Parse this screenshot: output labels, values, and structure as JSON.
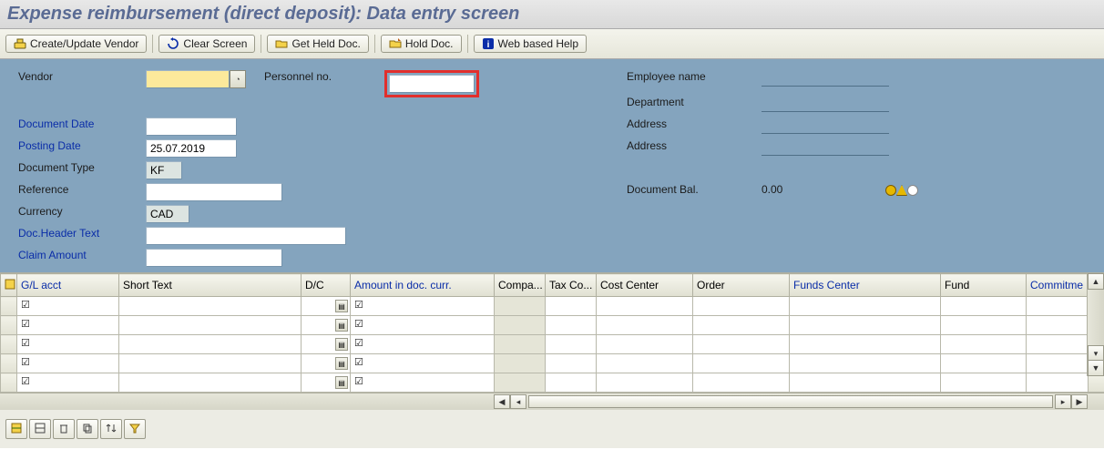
{
  "title": "Expense reimbursement (direct deposit): Data entry screen",
  "toolbar": {
    "create_update_vendor": "Create/Update Vendor",
    "clear_screen": "Clear Screen",
    "get_held_doc": "Get Held Doc.",
    "hold_doc": "Hold Doc.",
    "web_help": "Web based Help"
  },
  "labels": {
    "vendor": "Vendor",
    "personnel_no": "Personnel no.",
    "employee_name": "Employee name",
    "department": "Department",
    "address1": "Address",
    "address2": "Address",
    "document_date": "Document Date",
    "posting_date": "Posting Date",
    "document_type": "Document Type",
    "reference": "Reference",
    "currency": "Currency",
    "doc_header_text": "Doc.Header Text",
    "claim_amount": "Claim Amount",
    "document_bal": "Document Bal."
  },
  "values": {
    "vendor": "",
    "personnel_no": "",
    "employee_name": "",
    "department": "",
    "address1": "",
    "address2": "",
    "document_date": "",
    "posting_date": "25.07.2019",
    "document_type": "KF",
    "reference": "",
    "currency": "CAD",
    "doc_header_text": "",
    "claim_amount": "",
    "document_bal": "0.00"
  },
  "table": {
    "headers": {
      "gl_acct": "G/L acct",
      "short_text": "Short Text",
      "dc": "D/C",
      "amount": "Amount in doc. curr.",
      "compa": "Compa...",
      "tax_co": "Tax Co...",
      "cost_center": "Cost Center",
      "order": "Order",
      "funds_center": "Funds Center",
      "fund": "Fund",
      "commitment": "Commitme"
    },
    "row_count": 5
  },
  "bottom_icons": [
    "insert-row-icon",
    "delete-row-icon",
    "trash-icon",
    "copy-icon",
    "sort-icon",
    "filter-icon"
  ]
}
